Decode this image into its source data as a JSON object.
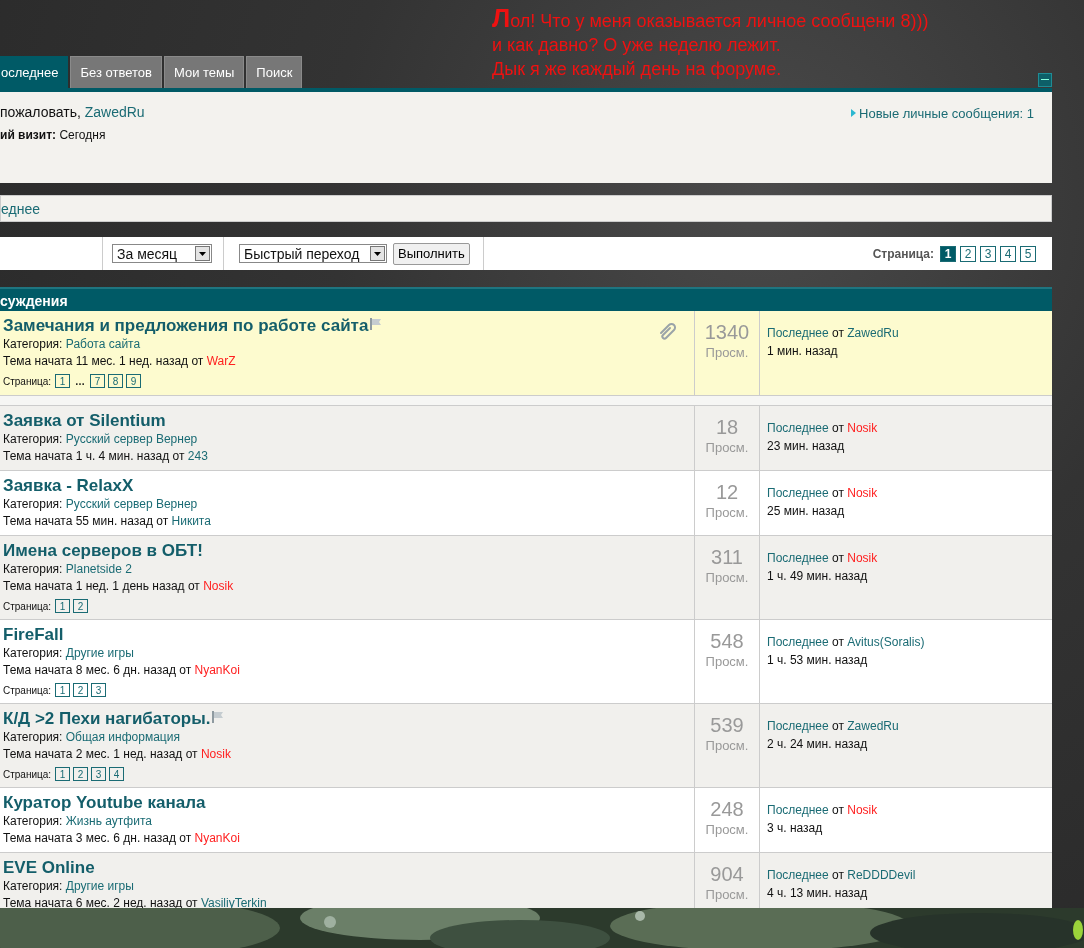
{
  "annotation": {
    "lines": [
      "Лол! Что у меня оказывается личное сообщени 8)))",
      "и как давно? О уже неделю лежит.",
      "Дык я же каждый день на форуме."
    ]
  },
  "tabs": [
    {
      "label": "оследнее",
      "selected": true
    },
    {
      "label": "Без ответов",
      "selected": false
    },
    {
      "label": "Мои темы",
      "selected": false
    },
    {
      "label": "Поиск",
      "selected": false
    }
  ],
  "welcome": {
    "greeting": "пожаловать,",
    "user": "ZawedRu",
    "last_visit_label": "ий визит:",
    "last_visit": "Сегодня",
    "messages_link": "Новые личные сообщения: 1"
  },
  "breadcrumb": "еднее",
  "toolbar": {
    "period": "За месяц",
    "jump": "Быстрый переход",
    "go_button": "Выполнить",
    "pages_label": "Страница:",
    "pages": [
      {
        "label": "1",
        "selected": true
      },
      {
        "label": "2",
        "selected": false
      },
      {
        "label": "3",
        "selected": false
      },
      {
        "label": "4",
        "selected": false
      },
      {
        "label": "5",
        "selected": false
      }
    ]
  },
  "section": {
    "title": "суждения"
  },
  "topics": [
    {
      "kind": "pinned",
      "title": "Замечания и предложения по работе сайта",
      "flagged": true,
      "attachment": true,
      "category_label": "Категория:",
      "category": "Работа сайта",
      "started": "Тема начата 11 мес. 1 нед. назад от",
      "starter": {
        "name": "WarZ",
        "color": "#ff2020"
      },
      "pages_label": "Страница:",
      "pages": [
        {
          "kind": "link",
          "label": "1"
        },
        {
          "kind": "gap",
          "label": "…"
        },
        {
          "kind": "link",
          "label": "7"
        },
        {
          "kind": "link",
          "label": "8"
        },
        {
          "kind": "link",
          "label": "9"
        }
      ],
      "views": "1340",
      "views_label": "Просм.",
      "last_label": "Последнее",
      "last_from": "от",
      "last_by": {
        "name": "ZawedRu",
        "color": "#1a6b74"
      },
      "last_time": "1 мин. назад"
    },
    {
      "kind": "normal",
      "title": "Заявка от Silentium",
      "flagged": false,
      "attachment": false,
      "category_label": "Категория:",
      "category": "Русский сервер Вернер",
      "started": "Тема начата 1 ч. 4 мин. назад от",
      "starter": {
        "name": "243",
        "color": "#1a6b74"
      },
      "views": "18",
      "views_label": "Просм.",
      "last_label": "Последнее",
      "last_from": "от",
      "last_by": {
        "name": "Nosik",
        "color": "#ff2020"
      },
      "last_time": "23 мин. назад"
    },
    {
      "kind": "normal",
      "title": "Заявка - RelaxX",
      "flagged": false,
      "attachment": false,
      "category_label": "Категория:",
      "category": "Русский сервер Вернер",
      "started": "Тема начата 55 мин. назад от",
      "starter": {
        "name": "Никита",
        "color": "#1a6b74"
      },
      "views": "12",
      "views_label": "Просм.",
      "last_label": "Последнее",
      "last_from": "от",
      "last_by": {
        "name": "Nosik",
        "color": "#ff2020"
      },
      "last_time": "25 мин. назад"
    },
    {
      "kind": "normal",
      "title": "Имена серверов в ОБТ!",
      "flagged": false,
      "attachment": false,
      "category_label": "Категория:",
      "category": "Planetside 2",
      "started": "Тема начата 1 нед. 1 день назад от",
      "starter": {
        "name": "Nosik",
        "color": "#ff2020"
      },
      "pages_label": "Страница:",
      "pages": [
        {
          "kind": "link",
          "label": "1"
        },
        {
          "kind": "link",
          "label": "2"
        }
      ],
      "views": "311",
      "views_label": "Просм.",
      "last_label": "Последнее",
      "last_from": "от",
      "last_by": {
        "name": "Nosik",
        "color": "#ff2020"
      },
      "last_time": "1 ч. 49 мин. назад"
    },
    {
      "kind": "normal",
      "title": "FireFall",
      "flagged": false,
      "attachment": false,
      "category_label": "Категория:",
      "category": "Другие игры",
      "started": "Тема начата 8 мес. 6 дн. назад от",
      "starter": {
        "name": "NyanKoi",
        "color": "#ff2020"
      },
      "pages_label": "Страница:",
      "pages": [
        {
          "kind": "link",
          "label": "1"
        },
        {
          "kind": "link",
          "label": "2"
        },
        {
          "kind": "link",
          "label": "3"
        }
      ],
      "views": "548",
      "views_label": "Просм.",
      "last_label": "Последнее",
      "last_from": "от",
      "last_by": {
        "name": "Avitus(Soralis)",
        "color": "#1a6b74"
      },
      "last_time": "1 ч. 53 мин. назад"
    },
    {
      "kind": "normal",
      "title": "К/Д >2 Пехи нагибаторы.",
      "flagged": true,
      "attachment": false,
      "category_label": "Категория:",
      "category": "Общая информация",
      "started": "Тема начата 2 мес. 1 нед. назад от",
      "starter": {
        "name": "Nosik",
        "color": "#ff2020"
      },
      "pages_label": "Страница:",
      "pages": [
        {
          "kind": "link",
          "label": "1"
        },
        {
          "kind": "link",
          "label": "2"
        },
        {
          "kind": "link",
          "label": "3"
        },
        {
          "kind": "link",
          "label": "4"
        }
      ],
      "views": "539",
      "views_label": "Просм.",
      "last_label": "Последнее",
      "last_from": "от",
      "last_by": {
        "name": "ZawedRu",
        "color": "#1a6b74"
      },
      "last_time": "2 ч. 24 мин. назад"
    },
    {
      "kind": "normal",
      "title": "Куратор Youtube канала",
      "flagged": false,
      "attachment": false,
      "category_label": "Категория:",
      "category": "Жизнь аутфита",
      "started": "Тема начата 3 мес. 6 дн. назад от",
      "starter": {
        "name": "NyanKoi",
        "color": "#ff2020"
      },
      "views": "248",
      "views_label": "Просм.",
      "last_label": "Последнее",
      "last_from": "от",
      "last_by": {
        "name": "Nosik",
        "color": "#ff2020"
      },
      "last_time": "3 ч. назад"
    },
    {
      "kind": "normal",
      "title": "EVE Online",
      "flagged": false,
      "attachment": false,
      "category_label": "Категория:",
      "category": "Другие игры",
      "started": "Тема начата 6 мес. 2 нед. назад от",
      "starter": {
        "name": "VasiliyTerkin",
        "color": "#1a6b74"
      },
      "views": "904",
      "views_label": "Просм.",
      "last_label": "Последнее",
      "last_from": "от",
      "last_by": {
        "name": "ReDDDDevil",
        "color": "#1a6b74"
      },
      "last_time": "4 ч. 13 мин. назад"
    }
  ]
}
